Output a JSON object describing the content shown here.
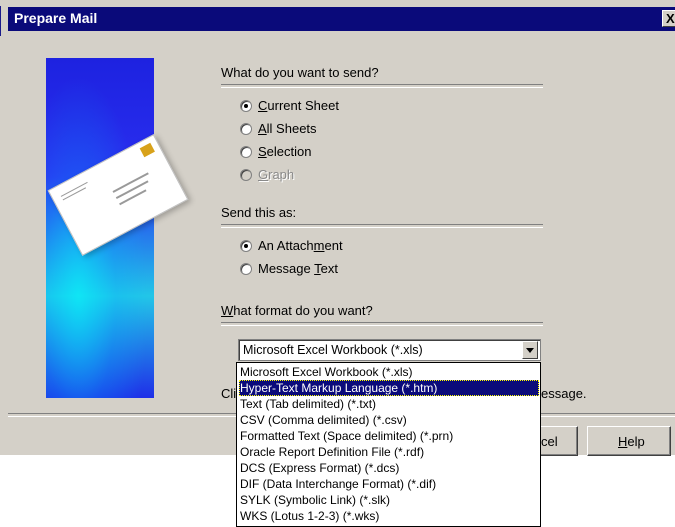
{
  "window": {
    "title": "Prepare Mail",
    "close_label": "X"
  },
  "send_section": {
    "heading": "What do you want to send?",
    "options": [
      {
        "label": "Current Sheet",
        "accesskey": "C",
        "rest": "urrent Sheet",
        "checked": true,
        "disabled": false
      },
      {
        "label": "All Sheets",
        "accesskey": "A",
        "rest": "ll Sheets",
        "checked": false,
        "disabled": false
      },
      {
        "label": "Selection",
        "accesskey": "S",
        "rest": "election",
        "checked": false,
        "disabled": false
      },
      {
        "label": "Graph",
        "accesskey": "G",
        "rest": "raph",
        "checked": false,
        "disabled": true
      }
    ]
  },
  "send_as_section": {
    "heading": "Send this as:",
    "attachment": {
      "pre": "An Attach",
      "accesskey": "m",
      "post": "ent",
      "checked": true
    },
    "message_text": {
      "pre": "Message ",
      "accesskey": "T",
      "post": "ext",
      "checked": false
    }
  },
  "format_section": {
    "heading_accesskey": "W",
    "heading_rest": "hat format do you want?",
    "selected_value": "Microsoft Excel Workbook (*.xls)",
    "options": [
      "Microsoft Excel Workbook (*.xls)",
      "Hyper-Text Markup Language (*.htm)",
      "Text (Tab delimited) (*.txt)",
      "CSV (Comma delimited) (*.csv)",
      "Formatted Text (Space delimited) (*.prn)",
      "Oracle Report Definition File (*.rdf)",
      "DCS (Express Format) (*.dcs)",
      "DIF (Data Interchange Format) (*.dif)",
      "SYLK (Symbolic Link) (*.slk)",
      "WKS (Lotus 1-2-3) (*.wks)"
    ],
    "highlighted_index": 1
  },
  "footer": {
    "hint_left": "Cli",
    "hint_right": "essage.",
    "cancel_partial": "cel",
    "help_accesskey": "H",
    "help_rest": "elp"
  }
}
